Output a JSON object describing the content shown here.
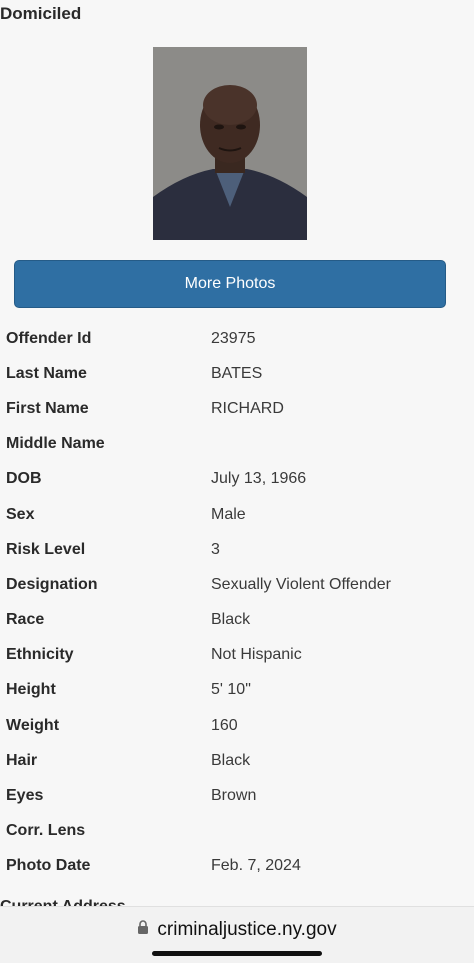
{
  "status": "Domiciled",
  "more_photos_label": "More Photos",
  "details": [
    {
      "label": "Offender Id",
      "value": "23975"
    },
    {
      "label": "Last Name",
      "value": "BATES"
    },
    {
      "label": "First Name",
      "value": "RICHARD"
    },
    {
      "label": "Middle Name",
      "value": ""
    },
    {
      "label": "DOB",
      "value": "July 13, 1966"
    },
    {
      "label": "Sex",
      "value": "Male"
    },
    {
      "label": "Risk Level",
      "value": "3"
    },
    {
      "label": "Designation",
      "value": "Sexually Violent Offender"
    },
    {
      "label": "Race",
      "value": "Black"
    },
    {
      "label": "Ethnicity",
      "value": "Not Hispanic"
    },
    {
      "label": "Height",
      "value": "5' 10\""
    },
    {
      "label": "Weight",
      "value": "160"
    },
    {
      "label": "Hair",
      "value": "Black"
    },
    {
      "label": "Eyes",
      "value": "Brown"
    },
    {
      "label": "Corr. Lens",
      "value": ""
    },
    {
      "label": "Photo Date",
      "value": "Feb. 7, 2024"
    }
  ],
  "cutoff_heading": "Current Address",
  "browser": {
    "url": "criminaljustice.ny.gov",
    "lock_icon": "lock-icon"
  }
}
